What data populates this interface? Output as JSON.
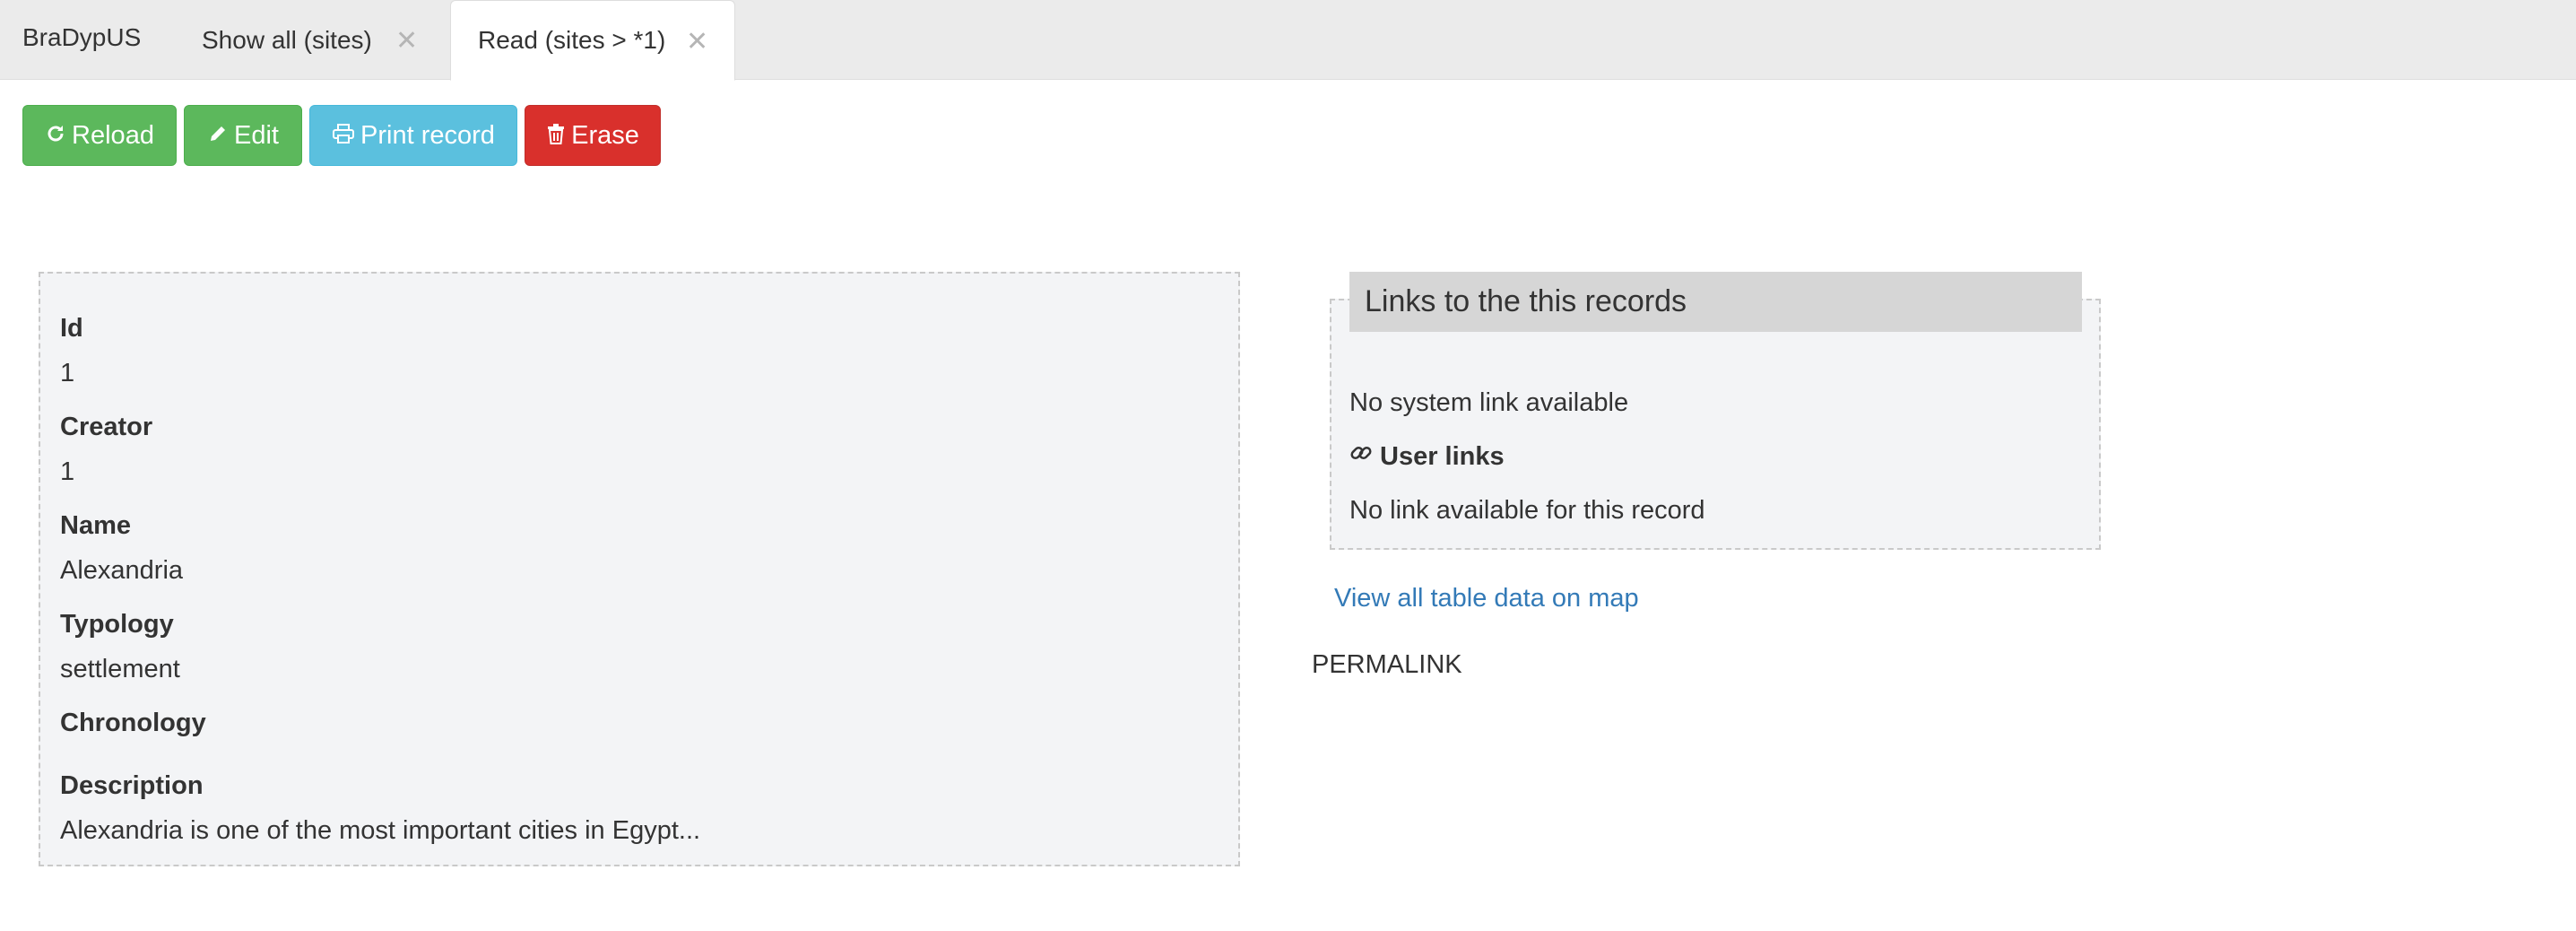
{
  "app": {
    "brand": "BraDypUS"
  },
  "tabs": [
    {
      "label": "Show all (sites)",
      "close": "✕",
      "active": false
    },
    {
      "label": "Read (sites > *1)",
      "close": "✕",
      "active": true
    }
  ],
  "toolbar": {
    "reload_label": "Reload",
    "edit_label": "Edit",
    "print_label": "Print record",
    "erase_label": "Erase",
    "colors": {
      "reload": "#5cb85c",
      "edit": "#5cb85c",
      "print": "#5bc0de",
      "erase": "#d9302c"
    },
    "icons": {
      "reload": "refresh-icon",
      "edit": "pencil-icon",
      "print": "printer-icon",
      "erase": "trash-icon"
    }
  },
  "record": {
    "fields": [
      {
        "label": "Id",
        "value": "1"
      },
      {
        "label": "Creator",
        "value": "1"
      },
      {
        "label": "Name",
        "value": "Alexandria"
      },
      {
        "label": "Typology",
        "value": "settlement"
      },
      {
        "label": "Chronology",
        "value": ""
      },
      {
        "label": "Description",
        "value": "Alexandria is one of the most important cities in Egypt..."
      }
    ]
  },
  "links": {
    "header": "Links to the this records",
    "system_links": "No system link available",
    "user_links_label": "User links",
    "user_links_icon": "link-icon",
    "user_links_empty": "No link available for this record"
  },
  "map_link": "View all table data on map",
  "permalink": "PERMALINK",
  "colors": {
    "link": "#337ab7",
    "panel_bg": "#f3f4f6",
    "header_bg": "#d6d6d6"
  }
}
